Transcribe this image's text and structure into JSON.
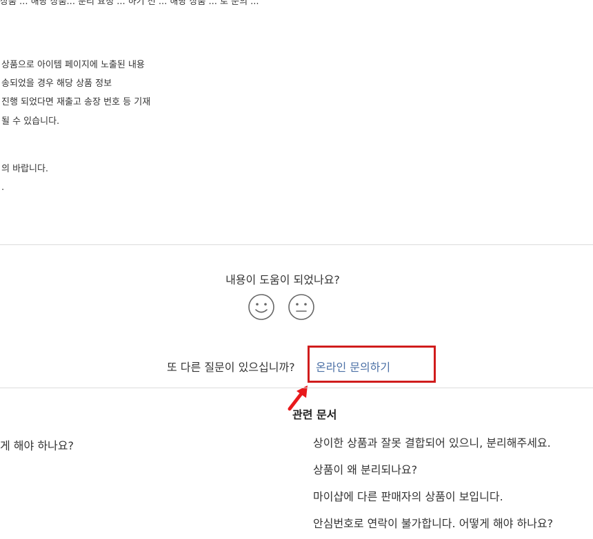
{
  "article": {
    "top_fragment": "상품 ... 해당 상품... 분리 요청 ... 하기 전 ... 해당 상품 ... 로 문의 ...",
    "lines": [
      "상품으로 아이템 페이지에 노출된 내용",
      "송되었을 경우 해당 상품 정보",
      "진행 되었다면 재출고 송장 번호 등 기재",
      "될 수 있습니다.",
      "의 바랍니다.",
      "."
    ]
  },
  "feedback": {
    "question": "내용이 도움이 되었나요?",
    "positive_label": "smile",
    "neutral_label": "neutral"
  },
  "contact": {
    "question": "또 다른 질문이 있으십니까?",
    "link_label": "온라인 문의하기"
  },
  "annotation": {
    "box_color": "#d01c1c",
    "arrow_color": "#e8191c"
  },
  "related": {
    "title": "관련 문서",
    "left_items": [
      "게 해야 하나요?"
    ],
    "right_items": [
      "상이한 상품과 잘못 결합되어 있으니, 분리해주세요.",
      "상품이 왜 분리되나요?",
      "마이샵에 다른 판매자의 상품이 보입니다.",
      "안심번호로 연락이 불가합니다. 어떻게 해야 하나요?"
    ]
  }
}
